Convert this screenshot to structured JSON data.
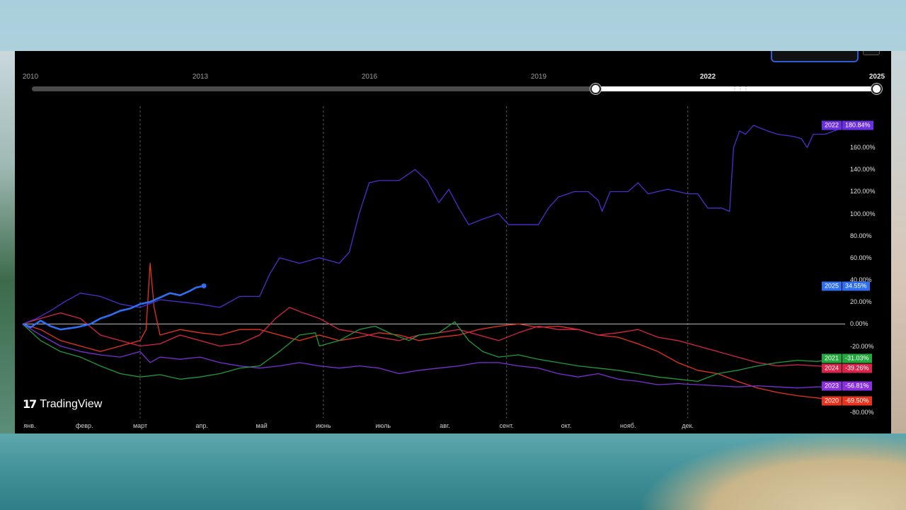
{
  "range_slider": {
    "year_labels": [
      "2010",
      "2013",
      "2016",
      "2019",
      "2022",
      "2025"
    ],
    "highlighted_years": [
      "2022",
      "2025"
    ]
  },
  "brand": {
    "name": "TradingView",
    "mark": "17"
  },
  "chart_data": {
    "type": "line",
    "x_unit": "day_of_year",
    "x_labels": [
      "янв.",
      "февр.",
      "март",
      "апр.",
      "май",
      "июнь",
      "июль",
      "авг.",
      "сент.",
      "окт.",
      "нояб.",
      "дек."
    ],
    "y_ticks": [
      180,
      160,
      140,
      120,
      100,
      80,
      60,
      40,
      20,
      0,
      -20,
      -40,
      -60,
      -80
    ],
    "y_tick_labels": [
      "",
      "160.00%",
      "140.00%",
      "120.00%",
      "100.00%",
      "80.00%",
      "60.00%",
      "40.00%",
      "20.00%",
      "0.00%",
      "-20.00%",
      "",
      "",
      "-80.00%"
    ],
    "ylim": [
      -80,
      190
    ],
    "xlim": [
      1,
      365
    ],
    "zero_line": true,
    "vertical_grid_dates_day": [
      60,
      152,
      244,
      335
    ],
    "series": [
      {
        "name": "2022",
        "color": "#4a2fcf",
        "label_bg": "#6a2fe0",
        "badge": "180.84%",
        "last_value": 180.84,
        "points": [
          [
            1,
            0
          ],
          [
            8,
            5
          ],
          [
            15,
            12
          ],
          [
            22,
            20
          ],
          [
            30,
            28
          ],
          [
            40,
            25
          ],
          [
            50,
            18
          ],
          [
            60,
            15
          ],
          [
            70,
            22
          ],
          [
            80,
            20
          ],
          [
            90,
            18
          ],
          [
            100,
            15
          ],
          [
            110,
            25
          ],
          [
            120,
            25
          ],
          [
            125,
            45
          ],
          [
            130,
            60
          ],
          [
            140,
            55
          ],
          [
            150,
            60
          ],
          [
            160,
            55
          ],
          [
            165,
            65
          ],
          [
            170,
            100
          ],
          [
            175,
            128
          ],
          [
            180,
            130
          ],
          [
            190,
            130
          ],
          [
            198,
            140
          ],
          [
            204,
            130
          ],
          [
            210,
            110
          ],
          [
            215,
            122
          ],
          [
            220,
            105
          ],
          [
            225,
            90
          ],
          [
            232,
            95
          ],
          [
            240,
            100
          ],
          [
            245,
            90
          ],
          [
            252,
            90
          ],
          [
            260,
            90
          ],
          [
            265,
            105
          ],
          [
            270,
            115
          ],
          [
            278,
            120
          ],
          [
            285,
            120
          ],
          [
            290,
            112
          ],
          [
            292,
            102
          ],
          [
            296,
            120
          ],
          [
            305,
            120
          ],
          [
            310,
            128
          ],
          [
            315,
            118
          ],
          [
            325,
            122
          ],
          [
            335,
            118
          ],
          [
            340,
            118
          ],
          [
            345,
            105
          ],
          [
            352,
            105
          ],
          [
            356,
            102
          ],
          [
            358,
            160
          ],
          [
            361,
            175
          ],
          [
            364,
            172
          ],
          [
            368,
            180
          ],
          [
            375,
            175
          ],
          [
            380,
            172
          ],
          [
            388,
            170
          ],
          [
            392,
            168
          ],
          [
            395,
            160
          ],
          [
            398,
            172
          ],
          [
            404,
            172
          ],
          [
            410,
            176
          ],
          [
            414,
            180
          ]
        ]
      },
      {
        "name": "2025",
        "color": "#2e6ff2",
        "label_bg": "#2e6ff2",
        "badge": "34.55%",
        "last_value": 34.55,
        "points": [
          [
            1,
            0
          ],
          [
            5,
            -3
          ],
          [
            10,
            3
          ],
          [
            15,
            -2
          ],
          [
            20,
            -5
          ],
          [
            28,
            -3
          ],
          [
            35,
            0
          ],
          [
            40,
            5
          ],
          [
            45,
            8
          ],
          [
            50,
            12
          ],
          [
            55,
            14
          ],
          [
            60,
            18
          ],
          [
            65,
            20
          ],
          [
            70,
            24
          ],
          [
            75,
            28
          ],
          [
            80,
            26
          ],
          [
            85,
            30
          ],
          [
            88,
            33
          ],
          [
            92,
            34.55
          ]
        ]
      },
      {
        "name": "2021",
        "color": "#1e9b3a",
        "label_bg": "#22a83c",
        "badge": "-31.03%",
        "last_value": -31.03,
        "points": [
          [
            1,
            0
          ],
          [
            10,
            -15
          ],
          [
            20,
            -25
          ],
          [
            30,
            -30
          ],
          [
            40,
            -38
          ],
          [
            50,
            -45
          ],
          [
            60,
            -48
          ],
          [
            70,
            -46
          ],
          [
            80,
            -50
          ],
          [
            90,
            -48
          ],
          [
            100,
            -45
          ],
          [
            110,
            -40
          ],
          [
            120,
            -38
          ],
          [
            130,
            -25
          ],
          [
            140,
            -10
          ],
          [
            148,
            -8
          ],
          [
            150,
            -20
          ],
          [
            160,
            -15
          ],
          [
            170,
            -5
          ],
          [
            178,
            -2
          ],
          [
            185,
            -8
          ],
          [
            195,
            -15
          ],
          [
            200,
            -10
          ],
          [
            210,
            -8
          ],
          [
            218,
            2
          ],
          [
            225,
            -15
          ],
          [
            232,
            -25
          ],
          [
            240,
            -30
          ],
          [
            250,
            -28
          ],
          [
            260,
            -32
          ],
          [
            270,
            -35
          ],
          [
            280,
            -38
          ],
          [
            290,
            -40
          ],
          [
            300,
            -42
          ],
          [
            310,
            -45
          ],
          [
            320,
            -48
          ],
          [
            330,
            -50
          ],
          [
            340,
            -52
          ],
          [
            350,
            -45
          ],
          [
            360,
            -42
          ],
          [
            370,
            -38
          ],
          [
            380,
            -35
          ],
          [
            390,
            -33
          ],
          [
            400,
            -34
          ],
          [
            410,
            -31
          ]
        ]
      },
      {
        "name": "2024",
        "color": "#d8234a",
        "label_bg": "#d8234a",
        "badge": "-39.26%",
        "last_value": -39.26,
        "points": [
          [
            1,
            0
          ],
          [
            10,
            5
          ],
          [
            20,
            10
          ],
          [
            30,
            5
          ],
          [
            40,
            -10
          ],
          [
            50,
            -15
          ],
          [
            60,
            -20
          ],
          [
            70,
            -18
          ],
          [
            80,
            -10
          ],
          [
            90,
            -15
          ],
          [
            100,
            -20
          ],
          [
            110,
            -18
          ],
          [
            120,
            -10
          ],
          [
            128,
            5
          ],
          [
            135,
            15
          ],
          [
            142,
            10
          ],
          [
            150,
            5
          ],
          [
            160,
            -5
          ],
          [
            170,
            -8
          ],
          [
            180,
            -12
          ],
          [
            190,
            -15
          ],
          [
            200,
            -10
          ],
          [
            210,
            -8
          ],
          [
            220,
            -5
          ],
          [
            230,
            -10
          ],
          [
            240,
            -15
          ],
          [
            250,
            -8
          ],
          [
            260,
            -2
          ],
          [
            270,
            -5
          ],
          [
            280,
            -5
          ],
          [
            290,
            -10
          ],
          [
            300,
            -8
          ],
          [
            310,
            -5
          ],
          [
            320,
            -12
          ],
          [
            330,
            -15
          ],
          [
            340,
            -20
          ],
          [
            350,
            -25
          ],
          [
            360,
            -30
          ],
          [
            370,
            -35
          ],
          [
            380,
            -38
          ],
          [
            390,
            -37
          ],
          [
            400,
            -38
          ],
          [
            410,
            -39
          ]
        ]
      },
      {
        "name": "2023",
        "color": "#7a2fd8",
        "label_bg": "#8a2fe0",
        "badge": "-56.81%",
        "last_value": -56.81,
        "points": [
          [
            1,
            0
          ],
          [
            10,
            -10
          ],
          [
            20,
            -20
          ],
          [
            30,
            -25
          ],
          [
            40,
            -28
          ],
          [
            50,
            -30
          ],
          [
            60,
            -25
          ],
          [
            65,
            -35
          ],
          [
            70,
            -30
          ],
          [
            80,
            -32
          ],
          [
            90,
            -30
          ],
          [
            100,
            -35
          ],
          [
            110,
            -38
          ],
          [
            120,
            -40
          ],
          [
            130,
            -38
          ],
          [
            140,
            -35
          ],
          [
            150,
            -38
          ],
          [
            160,
            -40
          ],
          [
            170,
            -38
          ],
          [
            180,
            -40
          ],
          [
            190,
            -45
          ],
          [
            200,
            -42
          ],
          [
            210,
            -40
          ],
          [
            220,
            -38
          ],
          [
            230,
            -35
          ],
          [
            240,
            -35
          ],
          [
            250,
            -38
          ],
          [
            260,
            -40
          ],
          [
            270,
            -45
          ],
          [
            280,
            -48
          ],
          [
            290,
            -45
          ],
          [
            300,
            -50
          ],
          [
            310,
            -52
          ],
          [
            320,
            -55
          ],
          [
            330,
            -54
          ],
          [
            340,
            -55
          ],
          [
            350,
            -56
          ],
          [
            360,
            -57
          ],
          [
            370,
            -56
          ],
          [
            380,
            -57
          ],
          [
            390,
            -58
          ],
          [
            400,
            -57
          ],
          [
            410,
            -57
          ]
        ]
      },
      {
        "name": "2020",
        "color": "#e8331e",
        "label_bg": "#e8331e",
        "badge": "-69.50%",
        "last_value": -69.5,
        "points": [
          [
            1,
            0
          ],
          [
            10,
            -5
          ],
          [
            20,
            -15
          ],
          [
            30,
            -20
          ],
          [
            40,
            -25
          ],
          [
            50,
            -20
          ],
          [
            60,
            -15
          ],
          [
            63,
            -5
          ],
          [
            65,
            55
          ],
          [
            67,
            15
          ],
          [
            70,
            -10
          ],
          [
            80,
            -5
          ],
          [
            90,
            -8
          ],
          [
            100,
            -10
          ],
          [
            110,
            -5
          ],
          [
            120,
            -5
          ],
          [
            130,
            -10
          ],
          [
            140,
            -15
          ],
          [
            150,
            -10
          ],
          [
            160,
            -15
          ],
          [
            170,
            -12
          ],
          [
            180,
            -8
          ],
          [
            190,
            -10
          ],
          [
            200,
            -15
          ],
          [
            210,
            -12
          ],
          [
            220,
            -10
          ],
          [
            230,
            -5
          ],
          [
            240,
            -2
          ],
          [
            250,
            0
          ],
          [
            260,
            -3
          ],
          [
            270,
            -2
          ],
          [
            280,
            -5
          ],
          [
            290,
            -10
          ],
          [
            300,
            -12
          ],
          [
            310,
            -18
          ],
          [
            320,
            -25
          ],
          [
            330,
            -35
          ],
          [
            340,
            -42
          ],
          [
            350,
            -45
          ],
          [
            360,
            -52
          ],
          [
            370,
            -58
          ],
          [
            380,
            -62
          ],
          [
            390,
            -65
          ],
          [
            400,
            -67
          ],
          [
            410,
            -69.5
          ]
        ]
      }
    ]
  }
}
